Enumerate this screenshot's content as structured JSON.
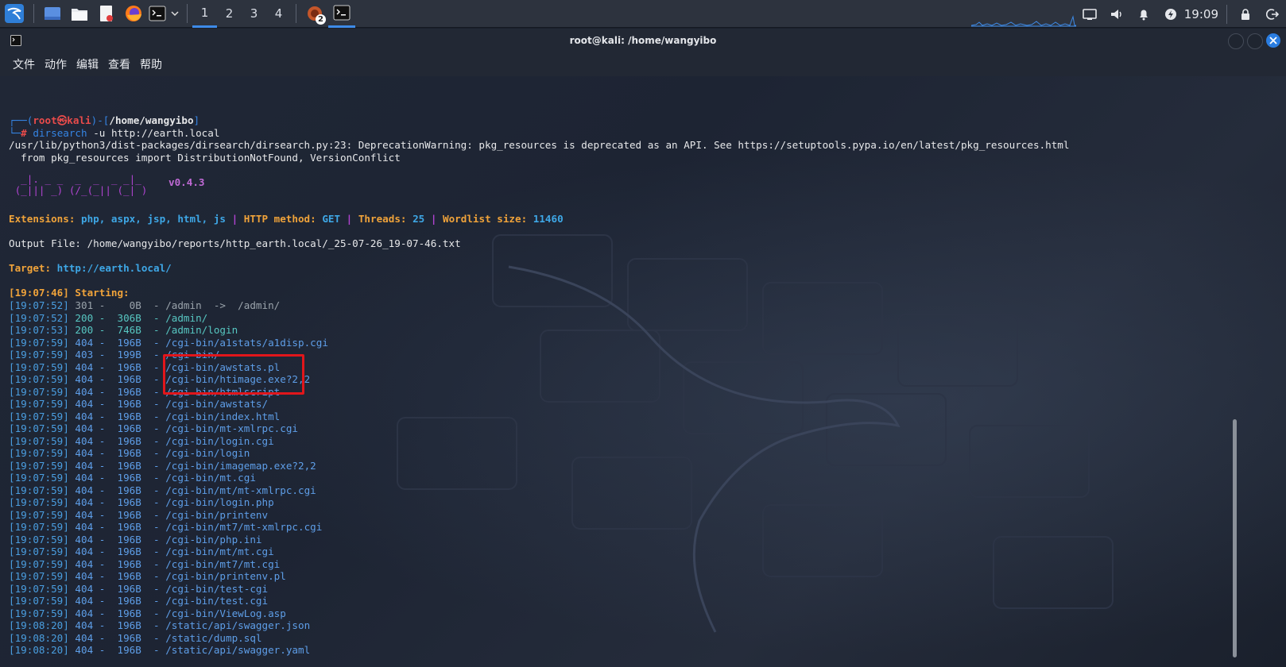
{
  "panel": {
    "workspaces": [
      "1",
      "2",
      "3",
      "4"
    ],
    "active_workspace": "1",
    "clock": "19:09",
    "notification_badge": "2",
    "accent": "#3d8be8"
  },
  "window": {
    "title": "root@kali: /home/wangyibo",
    "menu": [
      "文件",
      "动作",
      "编辑",
      "查看",
      "帮助"
    ]
  },
  "terminal": {
    "prompt": {
      "user": "root",
      "host": "kali",
      "cwd": "/home/wangyibo",
      "command": "dirsearch",
      "args": " -u http://earth.local"
    },
    "warning_lines": [
      "/usr/lib/python3/dist-packages/dirsearch/dirsearch.py:23: DeprecationWarning: pkg_resources is deprecated as an API. See https://setuptools.pypa.io/en/latest/pkg_resources.html",
      "  from pkg_resources import DistributionNotFound, VersionConflict"
    ],
    "banner": {
      "art_line1": "  _|. _ _  _  _  _ _|_",
      "art_line2": " (_||| _) (/_(_|| (_| )",
      "version": "v0.4.3"
    },
    "config": {
      "extensions_label": "Extensions:",
      "extensions": "php, aspx, jsp, html, js",
      "method_label": "HTTP method:",
      "method": "GET",
      "threads_label": "Threads:",
      "threads": "25",
      "wordlist_label": "Wordlist size:",
      "wordlist": "11460",
      "separator": " | "
    },
    "output_file": "Output File: /home/wangyibo/reports/http_earth.local/_25-07-26_19-07-46.txt",
    "target_label": "Target:",
    "target": "http://earth.local/",
    "starting": "[19:07:46] Starting:",
    "results": [
      {
        "time": "[19:07:52]",
        "code": "301",
        "size": "   0B",
        "path": "/admin  ->  /admin/"
      },
      {
        "time": "[19:07:52]",
        "code": "200",
        "size": " 306B",
        "path": "/admin/"
      },
      {
        "time": "[19:07:53]",
        "code": "200",
        "size": " 746B",
        "path": "/admin/login"
      },
      {
        "time": "[19:07:59]",
        "code": "404",
        "size": " 196B",
        "path": "/cgi-bin/a1stats/a1disp.cgi"
      },
      {
        "time": "[19:07:59]",
        "code": "403",
        "size": " 199B",
        "path": "/cgi-bin/"
      },
      {
        "time": "[19:07:59]",
        "code": "404",
        "size": " 196B",
        "path": "/cgi-bin/awstats.pl"
      },
      {
        "time": "[19:07:59]",
        "code": "404",
        "size": " 196B",
        "path": "/cgi-bin/htimage.exe?2,2"
      },
      {
        "time": "[19:07:59]",
        "code": "404",
        "size": " 196B",
        "path": "/cgi-bin/htmlscript"
      },
      {
        "time": "[19:07:59]",
        "code": "404",
        "size": " 196B",
        "path": "/cgi-bin/awstats/"
      },
      {
        "time": "[19:07:59]",
        "code": "404",
        "size": " 196B",
        "path": "/cgi-bin/index.html"
      },
      {
        "time": "[19:07:59]",
        "code": "404",
        "size": " 196B",
        "path": "/cgi-bin/mt-xmlrpc.cgi"
      },
      {
        "time": "[19:07:59]",
        "code": "404",
        "size": " 196B",
        "path": "/cgi-bin/login.cgi"
      },
      {
        "time": "[19:07:59]",
        "code": "404",
        "size": " 196B",
        "path": "/cgi-bin/login"
      },
      {
        "time": "[19:07:59]",
        "code": "404",
        "size": " 196B",
        "path": "/cgi-bin/imagemap.exe?2,2"
      },
      {
        "time": "[19:07:59]",
        "code": "404",
        "size": " 196B",
        "path": "/cgi-bin/mt.cgi"
      },
      {
        "time": "[19:07:59]",
        "code": "404",
        "size": " 196B",
        "path": "/cgi-bin/mt/mt-xmlrpc.cgi"
      },
      {
        "time": "[19:07:59]",
        "code": "404",
        "size": " 196B",
        "path": "/cgi-bin/login.php"
      },
      {
        "time": "[19:07:59]",
        "code": "404",
        "size": " 196B",
        "path": "/cgi-bin/printenv"
      },
      {
        "time": "[19:07:59]",
        "code": "404",
        "size": " 196B",
        "path": "/cgi-bin/mt7/mt-xmlrpc.cgi"
      },
      {
        "time": "[19:07:59]",
        "code": "404",
        "size": " 196B",
        "path": "/cgi-bin/php.ini"
      },
      {
        "time": "[19:07:59]",
        "code": "404",
        "size": " 196B",
        "path": "/cgi-bin/mt/mt.cgi"
      },
      {
        "time": "[19:07:59]",
        "code": "404",
        "size": " 196B",
        "path": "/cgi-bin/mt7/mt.cgi"
      },
      {
        "time": "[19:07:59]",
        "code": "404",
        "size": " 196B",
        "path": "/cgi-bin/printenv.pl"
      },
      {
        "time": "[19:07:59]",
        "code": "404",
        "size": " 196B",
        "path": "/cgi-bin/test-cgi"
      },
      {
        "time": "[19:07:59]",
        "code": "404",
        "size": " 196B",
        "path": "/cgi-bin/test.cgi"
      },
      {
        "time": "[19:07:59]",
        "code": "404",
        "size": " 196B",
        "path": "/cgi-bin/ViewLog.asp"
      },
      {
        "time": "[19:08:20]",
        "code": "404",
        "size": " 196B",
        "path": "/static/api/swagger.json"
      },
      {
        "time": "[19:08:20]",
        "code": "404",
        "size": " 196B",
        "path": "/static/dump.sql"
      },
      {
        "time": "[19:08:20]",
        "code": "404",
        "size": " 196B",
        "path": "/static/api/swagger.yaml"
      }
    ]
  }
}
